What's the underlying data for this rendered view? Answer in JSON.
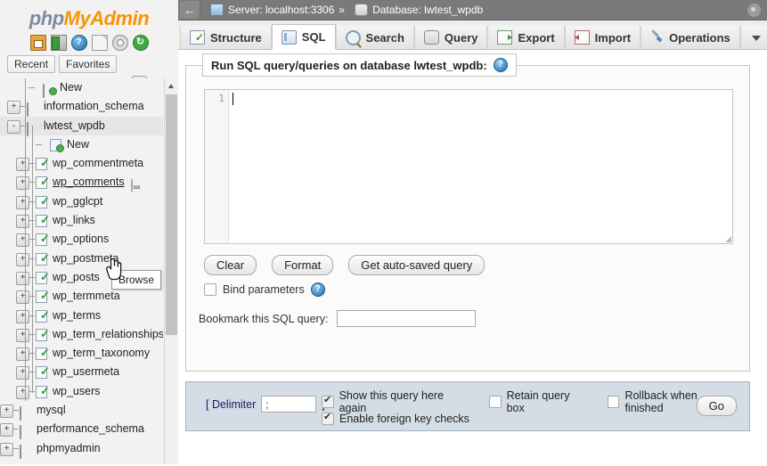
{
  "app": {
    "logo_left": "php",
    "logo_right": "MyAdmin"
  },
  "sidebar": {
    "nav_icons": [
      {
        "name": "home-icon",
        "label": "Home"
      },
      {
        "name": "logout-icon",
        "label": "Log out"
      },
      {
        "name": "docs-icon",
        "label": "?"
      },
      {
        "name": "documentation-icon",
        "label": "Documentation"
      },
      {
        "name": "settings-icon",
        "label": "Settings"
      },
      {
        "name": "reload-icon",
        "label": "↻"
      }
    ],
    "mini_tabs": [
      {
        "label": "Recent"
      },
      {
        "label": "Favorites"
      }
    ],
    "collapse_all_label": "",
    "tree": [
      {
        "label": "New",
        "type": "new-db",
        "indent": 40,
        "expander": "none"
      },
      {
        "label": "information_schema",
        "type": "db",
        "indent": 22,
        "expander": "+"
      },
      {
        "label": "lwtest_wpdb",
        "type": "db",
        "indent": 22,
        "expander": "-",
        "selected": true
      },
      {
        "label": "New",
        "type": "new-table",
        "indent": 48,
        "expander": "none"
      },
      {
        "label": "wp_commentmeta",
        "type": "table",
        "indent": 32,
        "expander": "+"
      },
      {
        "label": "wp_comments",
        "type": "table",
        "indent": 32,
        "expander": "+",
        "hovered": true
      },
      {
        "label": "wp_gglcpt",
        "type": "table",
        "indent": 32,
        "expander": "+"
      },
      {
        "label": "wp_links",
        "type": "table",
        "indent": 32,
        "expander": "+"
      },
      {
        "label": "wp_options",
        "type": "table",
        "indent": 32,
        "expander": "+"
      },
      {
        "label": "wp_postmeta",
        "type": "table",
        "indent": 32,
        "expander": "+"
      },
      {
        "label": "wp_posts",
        "type": "table",
        "indent": 32,
        "expander": "+"
      },
      {
        "label": "wp_termmeta",
        "type": "table",
        "indent": 32,
        "expander": "+"
      },
      {
        "label": "wp_terms",
        "type": "table",
        "indent": 32,
        "expander": "+"
      },
      {
        "label": "wp_term_relationships",
        "type": "table",
        "indent": 32,
        "expander": "+"
      },
      {
        "label": "wp_term_taxonomy",
        "type": "table",
        "indent": 32,
        "expander": "+"
      },
      {
        "label": "wp_usermeta",
        "type": "table",
        "indent": 32,
        "expander": "+"
      },
      {
        "label": "wp_users",
        "type": "table",
        "indent": 32,
        "expander": "+"
      },
      {
        "label": "mysql",
        "type": "db",
        "indent": 14,
        "expander": "+"
      },
      {
        "label": "performance_schema",
        "type": "db",
        "indent": 14,
        "expander": "+"
      },
      {
        "label": "phpmyadmin",
        "type": "db",
        "indent": 14,
        "expander": "+"
      }
    ],
    "tooltip": "Browse"
  },
  "serverbar": {
    "back_arrow": "←",
    "server_text": "Server: localhost:3306",
    "separator": "»",
    "database_text": "Database: lwtest_wpdb"
  },
  "tabs": [
    {
      "label": "Structure",
      "icon": "structure-icon",
      "active": false
    },
    {
      "label": "SQL",
      "icon": "sql-icon",
      "active": true
    },
    {
      "label": "Search",
      "icon": "search-icon",
      "active": false
    },
    {
      "label": "Query",
      "icon": "query-icon",
      "active": false
    },
    {
      "label": "Export",
      "icon": "export-icon",
      "active": false
    },
    {
      "label": "Import",
      "icon": "import-icon",
      "active": false
    },
    {
      "label": "Operations",
      "icon": "operations-icon",
      "active": false
    },
    {
      "label": "More",
      "icon": "more-icon",
      "active": false
    }
  ],
  "query_panel": {
    "legend": "Run SQL query/queries on database lwtest_wpdb:",
    "help_glyph": "?",
    "line_number": "1",
    "editor_value": "",
    "buttons": [
      {
        "label": "Clear",
        "name": "clear-button"
      },
      {
        "label": "Format",
        "name": "format-button"
      },
      {
        "label": "Get auto-saved query",
        "name": "get-auto-saved-query-button"
      }
    ],
    "bind_parameters": {
      "label": "Bind parameters",
      "checked": false
    },
    "bookmark": {
      "label": "Bookmark this SQL query:",
      "value": "",
      "placeholder": ""
    }
  },
  "options_bar": {
    "delimiter_open": "[ Delimiter",
    "delimiter_value": ";",
    "delimiter_close": "]",
    "checkboxes": [
      {
        "label": "Show this query here again",
        "checked": true,
        "name": "show-query-again-checkbox"
      },
      {
        "label": "Retain query box",
        "checked": false,
        "name": "retain-query-box-checkbox"
      },
      {
        "label": "Rollback when finished",
        "checked": false,
        "name": "rollback-when-finished-checkbox"
      },
      {
        "label": "Enable foreign key checks",
        "checked": true,
        "name": "enable-foreign-key-checks-checkbox"
      }
    ],
    "go_label": "Go"
  },
  "colors": {
    "logo_blue": "#7d8ca3",
    "logo_orange": "#f89406",
    "serverbar_bg": "#7a7a7a",
    "options_bg": "#d4dde6"
  }
}
